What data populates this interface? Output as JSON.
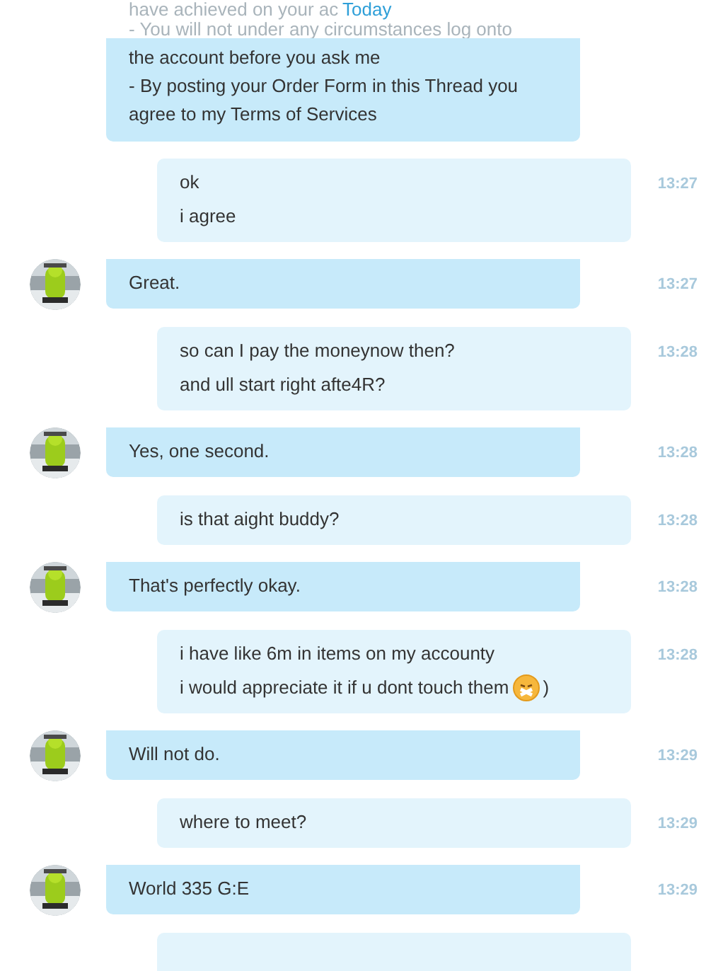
{
  "date_header": "Today",
  "faded_lines": [
    "have achieved on your ac",
    "- You will not under any circumstances log onto"
  ],
  "messages": [
    {
      "kind": "incoming",
      "avatar": false,
      "lines": [
        [
          {
            "kind": "text",
            "text": "the account before you ask me"
          }
        ],
        [
          {
            "kind": "text",
            "text": "- By posting your Order Form in this Thread you"
          }
        ],
        [
          {
            "kind": "text",
            "text": "agree to my Terms of Services"
          }
        ]
      ]
    },
    {
      "kind": "outgoing",
      "time": "13:27",
      "lines": [
        [
          {
            "kind": "text",
            "text": "ok"
          }
        ],
        [
          {
            "kind": "text",
            "text": "i agree"
          }
        ]
      ]
    },
    {
      "kind": "incoming",
      "avatar": true,
      "time": "13:27",
      "lines": [
        [
          {
            "kind": "text",
            "text": "Great."
          }
        ]
      ]
    },
    {
      "kind": "outgoing",
      "time": "13:28",
      "lines": [
        [
          {
            "kind": "text",
            "text": "so can I pay the moneynow then?"
          }
        ],
        [
          {
            "kind": "text",
            "text": "and ull start right afte4R?"
          }
        ]
      ]
    },
    {
      "kind": "incoming",
      "avatar": true,
      "time": "13:28",
      "lines": [
        [
          {
            "kind": "text",
            "text": "Yes, one second."
          }
        ]
      ]
    },
    {
      "kind": "outgoing",
      "time": "13:28",
      "lines": [
        [
          {
            "kind": "text",
            "text": "is that aight buddy?"
          }
        ]
      ]
    },
    {
      "kind": "incoming",
      "avatar": true,
      "time": "13:28",
      "lines": [
        [
          {
            "kind": "text",
            "text": "That's perfectly okay."
          }
        ]
      ]
    },
    {
      "kind": "outgoing",
      "time": "13:28",
      "lines": [
        [
          {
            "kind": "text",
            "text": "i have like 6m in items on my accounty"
          }
        ],
        [
          {
            "kind": "text",
            "text": "i would appreciate it if u dont touch them"
          },
          {
            "kind": "emoticon"
          },
          {
            "kind": "text",
            "text": ")"
          }
        ]
      ]
    },
    {
      "kind": "incoming",
      "avatar": true,
      "time": "13:29",
      "lines": [
        [
          {
            "kind": "text",
            "text": "Will not do."
          }
        ]
      ]
    },
    {
      "kind": "outgoing",
      "time": "13:29",
      "lines": [
        [
          {
            "kind": "text",
            "text": "where to meet?"
          }
        ]
      ]
    },
    {
      "kind": "incoming",
      "avatar": true,
      "time": "13:29",
      "lines": [
        [
          {
            "kind": "text",
            "text": "World 335 G:E"
          }
        ]
      ]
    },
    {
      "kind": "outgoing"
    }
  ]
}
